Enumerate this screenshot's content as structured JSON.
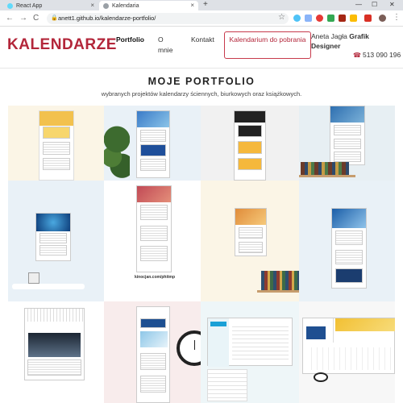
{
  "browser": {
    "tabs": [
      {
        "label": "React App"
      },
      {
        "label": "Kalendaria"
      }
    ],
    "new_tab": "+",
    "url": "anett1.github.io/kalendarze-portfolio/",
    "controls": {
      "minimize": "—",
      "maximize": "☐",
      "close": "✕"
    },
    "nav": {
      "back": "←",
      "forward": "→",
      "reload": "C",
      "star": "☆"
    }
  },
  "header": {
    "logo": "KALENDARZE",
    "menu": [
      {
        "label": "Portfolio"
      },
      {
        "label": "O mnie"
      },
      {
        "label": "Kontakt"
      }
    ],
    "cta": "Kalendarium do pobrania",
    "author_name": "Aneta Jagła",
    "author_role": "Grafik Designer",
    "phone": "513 090 196"
  },
  "portfolio": {
    "title": "MOJE PORTFOLIO",
    "subtitle": "wybranych projektów kalendarzy ściennych, biurkowych oraz książkowych.",
    "sticker_url": "kinocjan.com/phitmp"
  },
  "colors": {
    "brand": "#b3263a",
    "cream": "#fbf5e6",
    "lightblue": "#e9f1f7",
    "pink": "#f8ecec",
    "grey": "#f1f1f1"
  }
}
